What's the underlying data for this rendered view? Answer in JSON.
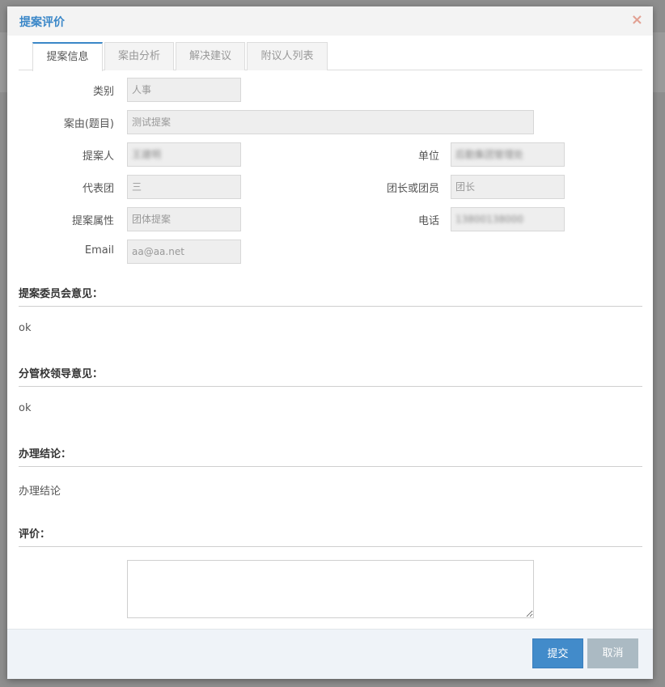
{
  "dialog": {
    "title": "提案评价",
    "close_symbol": "×"
  },
  "tabs": [
    {
      "label": "提案信息",
      "active": true
    },
    {
      "label": "案由分析",
      "active": false
    },
    {
      "label": "解决建议",
      "active": false
    },
    {
      "label": "附议人列表",
      "active": false
    }
  ],
  "form": {
    "category": {
      "label": "类别",
      "value": "人事"
    },
    "subject": {
      "label": "案由(题目)",
      "value": "测试提案"
    },
    "proposer": {
      "label": "提案人",
      "value": "王建明"
    },
    "unit": {
      "label": "单位",
      "value": "后勤集团管理处"
    },
    "delegation": {
      "label": "代表团",
      "value": "三"
    },
    "role": {
      "label": "团长或团员",
      "value": "团长"
    },
    "attribute": {
      "label": "提案属性",
      "value": "团体提案"
    },
    "phone": {
      "label": "电话",
      "value": "13800138000"
    },
    "email": {
      "label": "Email",
      "value": "aa@aa.net"
    }
  },
  "sections": {
    "committee": {
      "title": "提案委员会意见：",
      "text": "ok"
    },
    "leader": {
      "title": "分管校领导意见：",
      "text": "ok"
    },
    "conclusion": {
      "title": "办理结论：",
      "text": "办理结论"
    },
    "evaluation": {
      "title": "评价：",
      "value": ""
    }
  },
  "footer": {
    "submit_label": "提交",
    "cancel_label": "取消"
  },
  "colors": {
    "accent": "#428bca",
    "title": "#3a87c8",
    "close": "#e2a193",
    "cancel": "#abbac3"
  }
}
